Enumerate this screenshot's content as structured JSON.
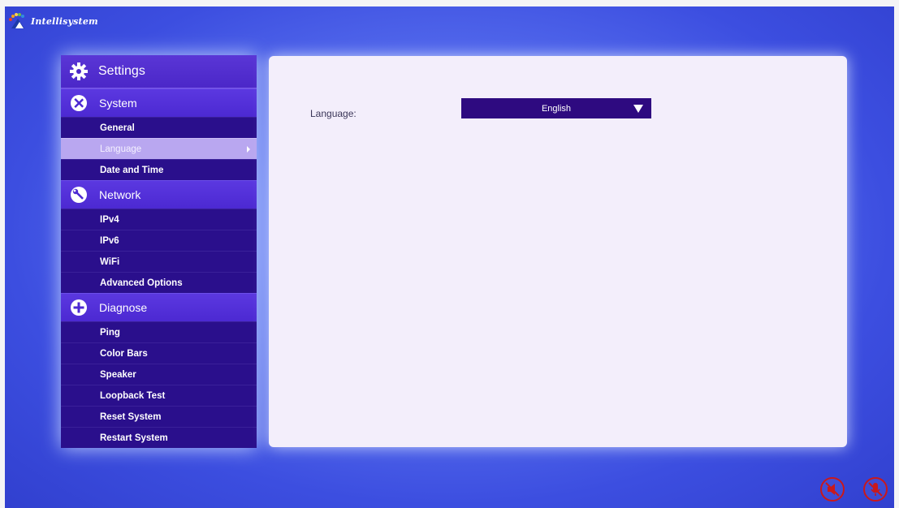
{
  "brand": {
    "logo_text": "Intellisystem"
  },
  "sidebar": {
    "title": "Settings",
    "groups": [
      {
        "label": "System",
        "icon": "tools-icon",
        "items": [
          {
            "label": "General"
          },
          {
            "label": "Language"
          },
          {
            "label": "Date and Time"
          }
        ]
      },
      {
        "label": "Network",
        "icon": "wrench-icon",
        "items": [
          {
            "label": "IPv4"
          },
          {
            "label": "IPv6"
          },
          {
            "label": "WiFi"
          },
          {
            "label": "Advanced Options"
          }
        ]
      },
      {
        "label": "Diagnose",
        "icon": "plus-icon",
        "items": [
          {
            "label": "Ping"
          },
          {
            "label": "Color Bars"
          },
          {
            "label": "Speaker"
          },
          {
            "label": "Loopback Test"
          },
          {
            "label": "Reset System"
          },
          {
            "label": "Restart System"
          }
        ]
      }
    ],
    "selected_item": "Language"
  },
  "main": {
    "language_label": "Language:",
    "language_value": "English"
  },
  "status_icons": [
    "speaker-muted-icon",
    "microphone-muted-icon"
  ],
  "colors": {
    "sidebar_bg": "#2a0f8c",
    "group_bg": "#4c29d2",
    "selected_bg": "#b9a7f0",
    "select_bg": "#2e0a80",
    "status_red": "#c9181b"
  }
}
